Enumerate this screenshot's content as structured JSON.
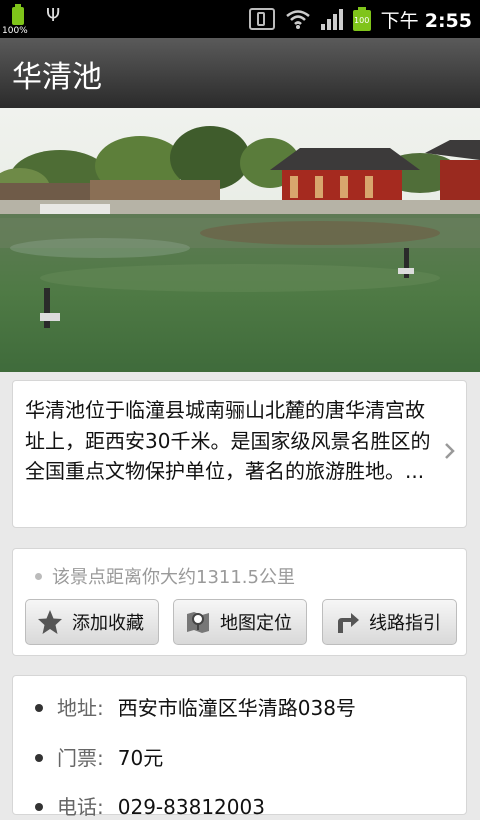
{
  "status_bar": {
    "battery_small_pct": "100%",
    "battery_big_pct": "100",
    "time_prefix": "下午",
    "time": "2:55",
    "icons": [
      "battery-icon",
      "usb-icon",
      "vibrate-icon",
      "wifi-icon",
      "signal-icon",
      "battery-icon"
    ]
  },
  "header": {
    "title": "华清池"
  },
  "description": {
    "text": "华清池位于临潼县城南骊山北麓的唐华清宫故址上，距西安30千米。是国家级风景名胜区的全国重点文物保护单位，著名的旅游胜地。..."
  },
  "distance": {
    "text": "该景点距离你大约1311.5公里"
  },
  "buttons": {
    "favorite_label": "添加收藏",
    "map_label": "地图定位",
    "route_label": "线路指引"
  },
  "info": {
    "address_label": "地址:",
    "address_value": "西安市临潼区华清路038号",
    "ticket_label": "门票:",
    "ticket_value": "70元",
    "phone_label": "电话:",
    "phone_value": "029-83812003"
  },
  "colors": {
    "accent_green": "#7fc41a",
    "titlebar": "#3a3a3a"
  }
}
